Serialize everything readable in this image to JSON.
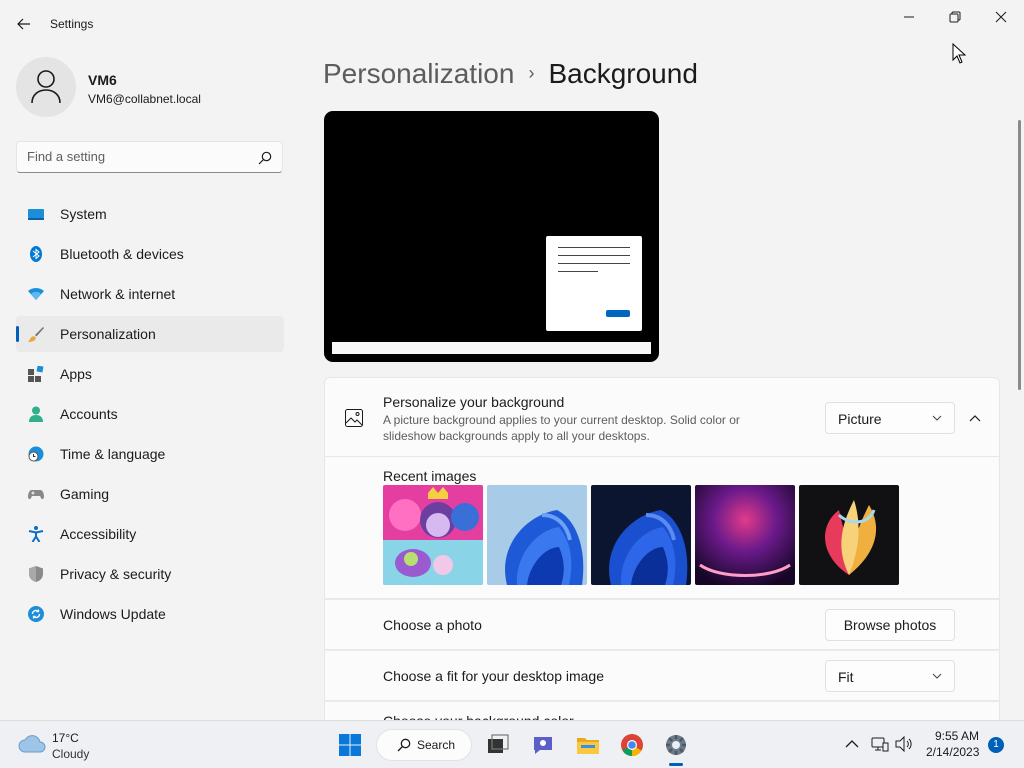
{
  "window": {
    "title": "Settings"
  },
  "user": {
    "name": "VM6",
    "email": "VM6@collabnet.local"
  },
  "search": {
    "placeholder": "Find a setting"
  },
  "sidebar": {
    "items": [
      {
        "label": "System",
        "icon": "system-icon"
      },
      {
        "label": "Bluetooth & devices",
        "icon": "bluetooth-icon"
      },
      {
        "label": "Network & internet",
        "icon": "wifi-icon"
      },
      {
        "label": "Personalization",
        "icon": "brush-icon",
        "active": true
      },
      {
        "label": "Apps",
        "icon": "apps-icon"
      },
      {
        "label": "Accounts",
        "icon": "accounts-icon"
      },
      {
        "label": "Time & language",
        "icon": "globe-clock-icon"
      },
      {
        "label": "Gaming",
        "icon": "gamepad-icon"
      },
      {
        "label": "Accessibility",
        "icon": "accessibility-icon"
      },
      {
        "label": "Privacy & security",
        "icon": "shield-icon"
      },
      {
        "label": "Windows Update",
        "icon": "update-icon"
      }
    ]
  },
  "breadcrumb": {
    "parent": "Personalization",
    "separator": "›",
    "current": "Background"
  },
  "background": {
    "title": "Personalize your background",
    "description": "A picture background applies to your current desktop. Solid color or slideshow backgrounds apply to all your desktops.",
    "type_value": "Picture",
    "recent_label": "Recent images",
    "recent_images": [
      "pony-characters-image",
      "blue-bloom-light-image",
      "blue-bloom-dark-image",
      "purple-glow-image",
      "colorful-petals-image"
    ],
    "choose_photo_label": "Choose a photo",
    "browse_label": "Browse photos",
    "fit_label": "Choose a fit for your desktop image",
    "fit_value": "Fit",
    "color_label": "Choose your background color"
  },
  "taskbar": {
    "weather_temp": "17°C",
    "weather_condition": "Cloudy",
    "search_label": "Search",
    "time": "9:55 AM",
    "date": "2/14/2023",
    "notification_count": "1"
  },
  "colors": {
    "accent": "#005fb8",
    "background": "#f3f3f3",
    "card": "#fbfbfb"
  }
}
